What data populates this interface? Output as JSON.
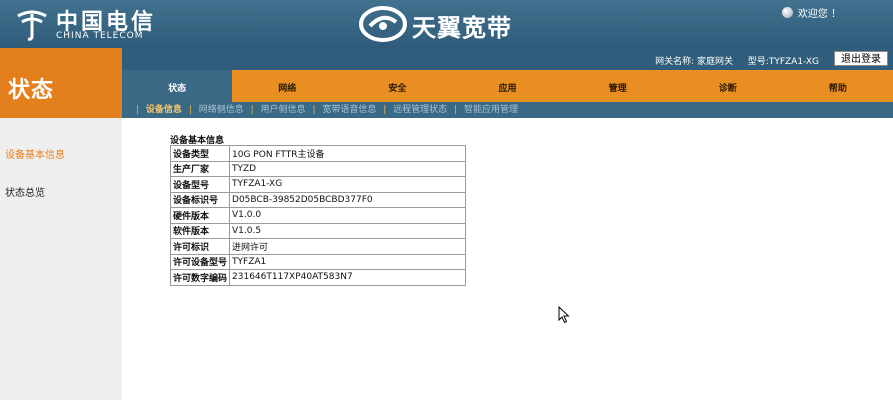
{
  "header": {
    "ct_logo_cn": "中国电信",
    "ct_logo_en": "CHINA TELECOM",
    "ty_logo": "天翼宽带",
    "welcome": "欢迎您 ！"
  },
  "status_title": "状态",
  "infobar": {
    "gateway_name": "网关名称: 家庭网关",
    "model": "型号:TYFZA1-XG",
    "logout": "退出登录"
  },
  "main_nav": [
    {
      "label": "状态",
      "active": true
    },
    {
      "label": "网络"
    },
    {
      "label": "安全"
    },
    {
      "label": "应用"
    },
    {
      "label": "管理"
    },
    {
      "label": "诊断"
    },
    {
      "label": "帮助"
    }
  ],
  "sub_nav": [
    {
      "label": "设备信息",
      "active": true
    },
    {
      "label": "网络侧信息"
    },
    {
      "label": "用户侧信息"
    },
    {
      "label": "宽带语音信息"
    },
    {
      "label": "远程管理状态"
    },
    {
      "label": "智能应用管理"
    }
  ],
  "sidebar": [
    {
      "label": "设备基本信息",
      "active": true
    },
    {
      "label": "状态总览"
    }
  ],
  "content": {
    "section_title": "设备基本信息",
    "rows": [
      {
        "key": "设备类型",
        "value": "10G PON FTTR主设备"
      },
      {
        "key": "生产厂家",
        "value": "TYZD"
      },
      {
        "key": "设备型号",
        "value": "TYFZA1-XG"
      },
      {
        "key": "设备标识号",
        "value": "D05BCB-39852D05BCBD377F0"
      },
      {
        "key": "硬件版本",
        "value": "V1.0.0"
      },
      {
        "key": "软件版本",
        "value": "V1.0.5"
      },
      {
        "key": "许可标识",
        "value": "进网许可"
      },
      {
        "key": "许可设备型号",
        "value": "TYFZA1"
      },
      {
        "key": "许可数字编码",
        "value": "231646T117XP40AT583N7"
      }
    ]
  },
  "colors": {
    "header_blue": "#2e5b79",
    "orange": "#e88e22",
    "active_tab_blue": "#3a6985",
    "sidebar_active": "#e47f1d"
  },
  "icons": [
    "china-telecom-logo-icon",
    "tianyi-logo-icon",
    "globe-icon",
    "mouse-cursor-icon"
  ]
}
